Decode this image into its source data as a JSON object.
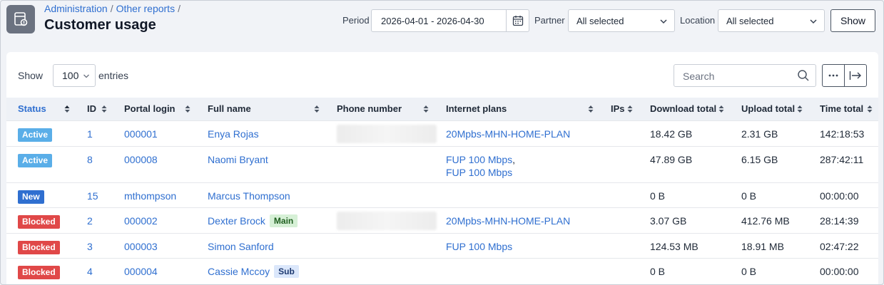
{
  "breadcrumb": [
    {
      "label": "Administration"
    },
    {
      "label": "Other reports"
    }
  ],
  "breadcrumb_sep": "/",
  "page_title": "Customer usage",
  "filters": {
    "period_label": "Period",
    "period_value": "2026-04-01 - 2026-04-30",
    "partner_label": "Partner",
    "partner_value": "All selected",
    "location_label": "Location",
    "location_value": "All selected",
    "show_button": "Show"
  },
  "table_controls": {
    "show_label": "Show",
    "entries_value": "100",
    "entries_label": "entries",
    "search_placeholder": "Search"
  },
  "columns": [
    "Status",
    "ID",
    "Portal login",
    "Full name",
    "Phone number",
    "Internet plans",
    "IPs",
    "Download total",
    "Upload total",
    "Time total"
  ],
  "rows": [
    {
      "status": "Active",
      "status_color": "#5aaee8",
      "id": "1",
      "login": "000001",
      "name": "Enya Rojas",
      "tag": "",
      "plans": [
        "20Mpbs-MHN-HOME-PLAN"
      ],
      "download": "18.42 GB",
      "upload": "2.31 GB",
      "time": "142:18:53",
      "phone_hidden": true
    },
    {
      "status": "Active",
      "status_color": "#5aaee8",
      "id": "8",
      "login": "000008",
      "name": "Naomi Bryant",
      "tag": "",
      "plans": [
        "FUP 100 Mbps",
        "FUP 100 Mbps"
      ],
      "download": "47.89 GB",
      "upload": "6.15 GB",
      "time": "287:42:11",
      "phone_hidden": false
    },
    {
      "status": "New",
      "status_color": "#2f6fd0",
      "id": "15",
      "login": "mthompson",
      "name": "Marcus Thompson",
      "tag": "",
      "plans": [],
      "download": "0 B",
      "upload": "0 B",
      "time": "00:00:00",
      "phone_hidden": false
    },
    {
      "status": "Blocked",
      "status_color": "#e04848",
      "id": "2",
      "login": "000002",
      "name": "Dexter Brock",
      "tag": "Main",
      "tag_bg": "#d6f0d6",
      "tag_color": "#1f5f1f",
      "plans": [
        "20Mpbs-MHN-HOME-PLAN"
      ],
      "download": "3.07 GB",
      "upload": "412.76 MB",
      "time": "28:14:39",
      "phone_hidden": true
    },
    {
      "status": "Blocked",
      "status_color": "#e04848",
      "id": "3",
      "login": "000003",
      "name": "Simon Sanford",
      "tag": "",
      "plans": [
        "FUP 100 Mbps"
      ],
      "download": "124.53 MB",
      "upload": "18.91 MB",
      "time": "02:47:22",
      "phone_hidden": false
    },
    {
      "status": "Blocked",
      "status_color": "#e04848",
      "id": "4",
      "login": "000004",
      "name": "Cassie Mccoy",
      "tag": "Sub",
      "tag_bg": "#dbe7fb",
      "tag_color": "#1e3a70",
      "plans": [],
      "download": "0 B",
      "upload": "0 B",
      "time": "00:00:00",
      "phone_hidden": false
    }
  ],
  "colors": {
    "accent": "#2f6fd0",
    "active": "#5aaee8",
    "new": "#2f6fd0",
    "blocked": "#e04848"
  }
}
